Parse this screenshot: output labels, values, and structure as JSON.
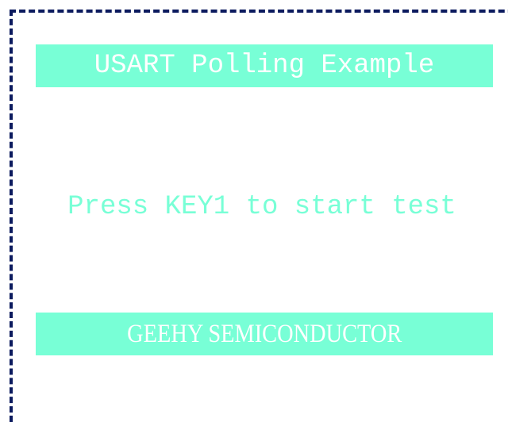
{
  "screen": {
    "title": "USART Polling Example",
    "message": "Press KEY1 to start test",
    "footer": "GEEHY SEMICONDUCTOR"
  },
  "colors": {
    "background": "#ffffff",
    "banner_fill": "#78ffd6",
    "banner_text": "#ffffff",
    "message_text": "#78ffd6",
    "frame_border": "#0b1a5e"
  }
}
